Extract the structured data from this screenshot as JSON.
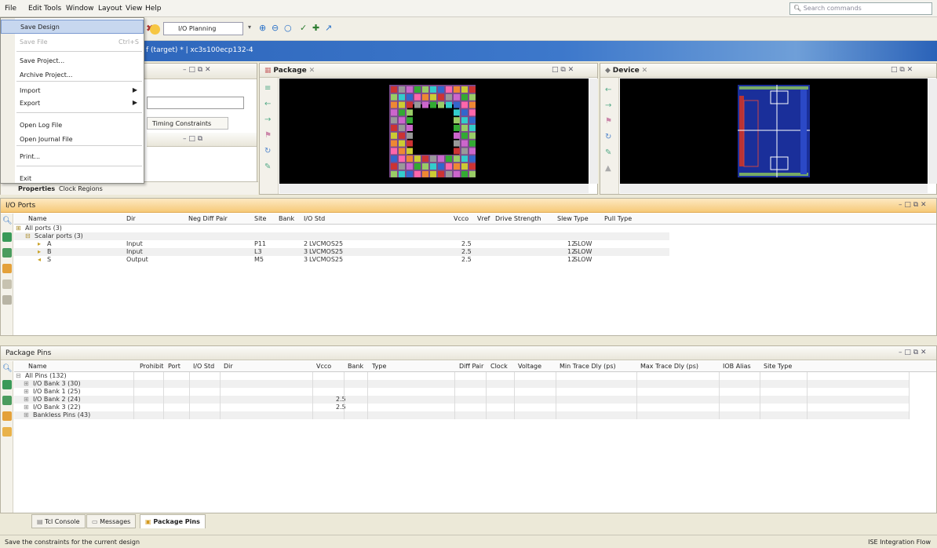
{
  "menubar": {
    "items": [
      "File",
      "Edit",
      "Tools",
      "Window",
      "Layout",
      "View",
      "Help"
    ],
    "search_placeholder": "Search commands"
  },
  "toolbar": {
    "layout_value": "I/O Planning"
  },
  "title": {
    "text": "f (target) * | xc3s100ecp132-4"
  },
  "file_menu": {
    "items": [
      {
        "label": "Save Design",
        "shortcut": "",
        "enabled": true,
        "submenu": false,
        "highlight": true
      },
      {
        "label": "Save File",
        "shortcut": "Ctrl+S",
        "enabled": false,
        "submenu": false
      },
      {
        "label": "Save Project...",
        "shortcut": "",
        "enabled": true,
        "submenu": false
      },
      {
        "label": "Archive Project...",
        "shortcut": "",
        "enabled": true,
        "submenu": false
      },
      {
        "label": "Import",
        "shortcut": "",
        "enabled": true,
        "submenu": true
      },
      {
        "label": "Export",
        "shortcut": "",
        "enabled": true,
        "submenu": true
      },
      {
        "label": "Open Log File",
        "shortcut": "",
        "enabled": true,
        "submenu": false
      },
      {
        "label": "Open Journal File",
        "shortcut": "",
        "enabled": true,
        "submenu": false
      },
      {
        "label": "Print...",
        "shortcut": "",
        "enabled": true,
        "submenu": false
      },
      {
        "label": "Exit",
        "shortcut": "",
        "enabled": true,
        "submenu": false
      }
    ]
  },
  "left_panel": {
    "timing_tab": "Timing Constraints",
    "properties_tab": "Properties",
    "clock_tab": "Clock Regions"
  },
  "package_view": {
    "title": "Package"
  },
  "device_view": {
    "title": "Device"
  },
  "io_ports": {
    "title": "I/O Ports",
    "columns": [
      "Name",
      "Dir",
      "Neg Diff Pair",
      "Site",
      "Bank",
      "I/O Std",
      "Vcco",
      "Vref",
      "Drive Strength",
      "Slew Type",
      "Pull Type"
    ],
    "rows": [
      {
        "name": "All ports (3)",
        "dir": "",
        "site": "",
        "bank": "",
        "std": "",
        "vcco": "",
        "drive": "",
        "slew": ""
      },
      {
        "name": "Scalar ports (3)",
        "dir": "",
        "site": "",
        "bank": "",
        "std": "",
        "vcco": "",
        "drive": "",
        "slew": ""
      },
      {
        "name": "A",
        "dir": "Input",
        "site": "P11",
        "bank": "2",
        "std": "LVCMOS25",
        "vcco": "2.5",
        "drive": "12",
        "slew": "SLOW"
      },
      {
        "name": "B",
        "dir": "Input",
        "site": "L3",
        "bank": "3",
        "std": "LVCMOS25",
        "vcco": "2.5",
        "drive": "12",
        "slew": "SLOW"
      },
      {
        "name": "S",
        "dir": "Output",
        "site": "M5",
        "bank": "3",
        "std": "LVCMOS25",
        "vcco": "2.5",
        "drive": "12",
        "slew": "SLOW"
      }
    ]
  },
  "package_pins": {
    "title": "Package Pins",
    "columns": [
      "Name",
      "Prohibit",
      "Port",
      "I/O Std",
      "Dir",
      "Vcco",
      "Bank",
      "Type",
      "Diff Pair",
      "Clock",
      "Voltage",
      "Min Trace Dly (ps)",
      "Max Trace Dly (ps)",
      "IOB Alias",
      "Site Type"
    ],
    "rows": [
      {
        "name": "All Pins (132)",
        "vcco": ""
      },
      {
        "name": "I/O Bank 3 (30)",
        "vcco": ""
      },
      {
        "name": "I/O Bank 1 (25)",
        "vcco": ""
      },
      {
        "name": "I/O Bank 2 (24)",
        "vcco": "2.5"
      },
      {
        "name": "I/O Bank 3 (22)",
        "vcco": "2.5"
      },
      {
        "name": "Bankless Pins (43)",
        "vcco": ""
      }
    ]
  },
  "bottom_tabs": [
    "Tcl Console",
    "Messages",
    "Package Pins"
  ],
  "status": {
    "left": "Save the constraints for the current design",
    "right": "ISE Integration Flow"
  }
}
